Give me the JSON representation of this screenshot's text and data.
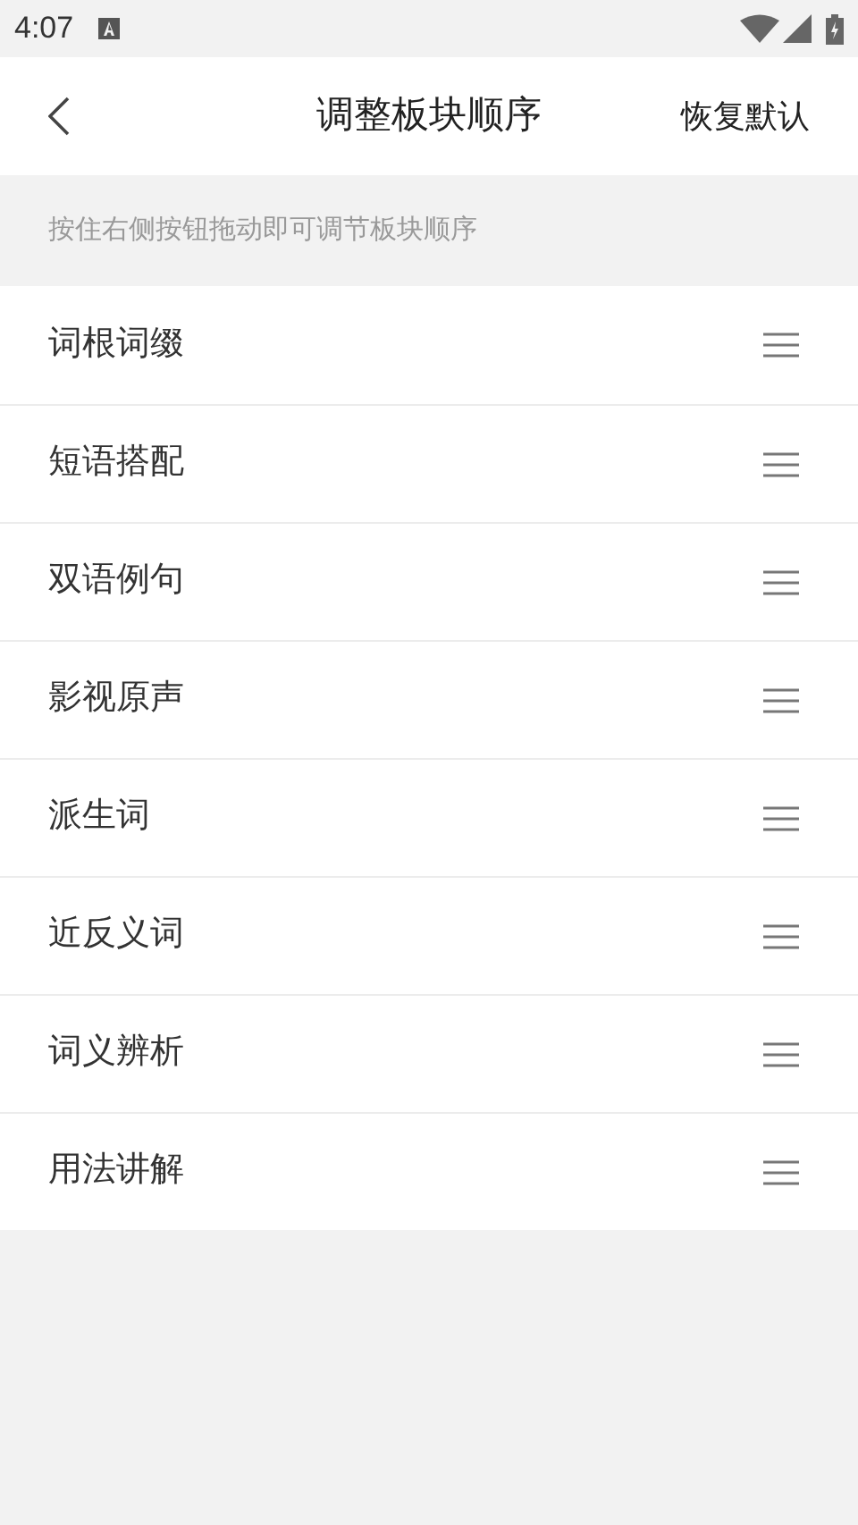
{
  "status_bar": {
    "time": "4:07"
  },
  "header": {
    "title": "调整板块顺序",
    "action": "恢复默认"
  },
  "hint": "按住右侧按钮拖动即可调节板块顺序",
  "sections": [
    {
      "label": "词根词缀"
    },
    {
      "label": "短语搭配"
    },
    {
      "label": "双语例句"
    },
    {
      "label": "影视原声"
    },
    {
      "label": "派生词"
    },
    {
      "label": "近反义词"
    },
    {
      "label": "词义辨析"
    },
    {
      "label": "用法讲解"
    }
  ]
}
